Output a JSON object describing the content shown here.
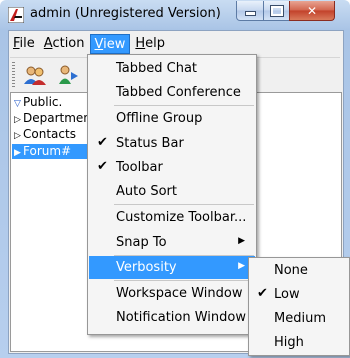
{
  "window": {
    "title": "admin (Unregistered Version)",
    "controls": {
      "minimize": "–",
      "maximize": "□",
      "close": "✕"
    }
  },
  "menubar": {
    "file": "File",
    "action": "Action",
    "view": "View",
    "help": "Help"
  },
  "toolbar": {
    "icons": [
      "users-icon",
      "user-transfer-icon"
    ]
  },
  "tree": {
    "nodes": [
      {
        "label": "Public.",
        "arrow": "▽"
      },
      {
        "label": "Department:",
        "arrow": "▷"
      },
      {
        "label": "Contacts",
        "arrow": "▷"
      },
      {
        "label": "Forum#",
        "arrow": "▶",
        "selected": true
      }
    ]
  },
  "view_menu": {
    "items": [
      {
        "label": "Tabbed Chat"
      },
      {
        "label": "Tabbed Conference"
      },
      {
        "label": "Offline Group"
      },
      {
        "label": "Status Bar",
        "checked": true
      },
      {
        "label": "Toolbar",
        "checked": true
      },
      {
        "label": "Auto Sort"
      },
      {
        "label": "Customize Toolbar..."
      },
      {
        "label": "Snap To",
        "submenu": true
      },
      {
        "label": "Verbosity",
        "submenu": true,
        "highlighted": true
      },
      {
        "label": "Workspace Window"
      },
      {
        "label": "Notification Window"
      }
    ],
    "check_glyph": "✔",
    "submenu_glyph": "▶"
  },
  "verbosity_menu": {
    "items": [
      {
        "label": "None"
      },
      {
        "label": "Low",
        "checked": true
      },
      {
        "label": "Medium"
      },
      {
        "label": "High"
      }
    ]
  },
  "colors": {
    "highlight": "#3399ff",
    "menu_bg": "#f5f5f5",
    "close_button": "#c2412a"
  }
}
